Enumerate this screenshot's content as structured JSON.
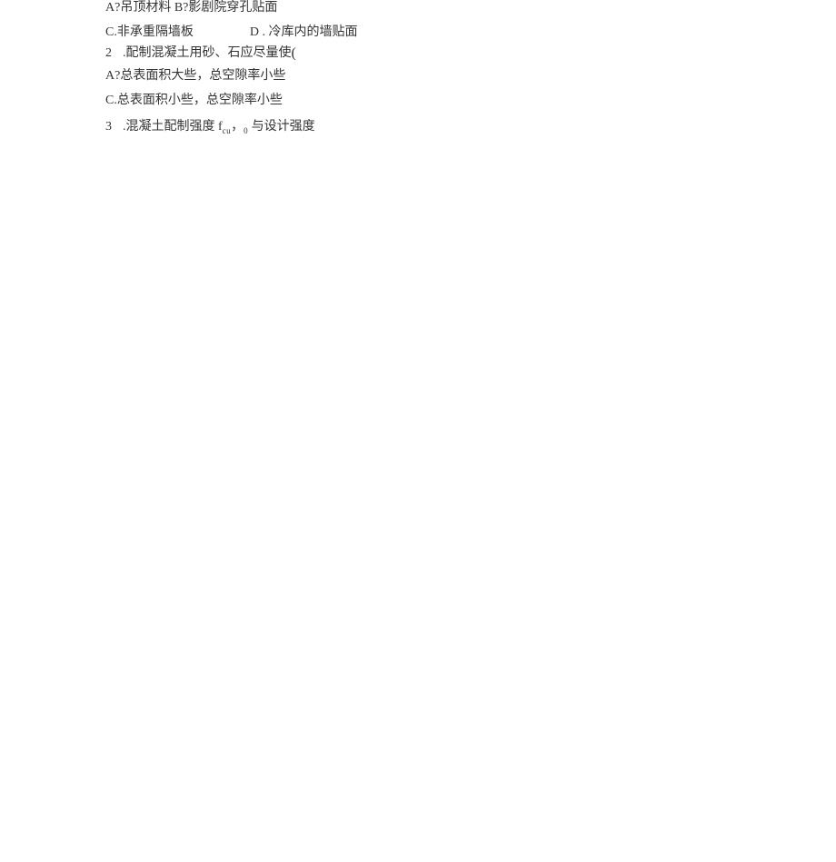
{
  "lines": {
    "l1": "A?吊顶材料 B?影剧院穿孔贴面",
    "l2a": "C.非承重隔墙板",
    "l2b": "D . 冷库内的墙贴面",
    "l3_num": "2",
    "l3_text": ".配制混凝土用砂、石应尽量使",
    "l3_paren": "(",
    "l4": "A?总表面积大些，总空隙率小些",
    "l5": "C.总表面积小些，总空隙率小些",
    "l6_num": "3",
    "l6_a": ".混凝土配制强度 f",
    "l6_sub1": "cu",
    "l6_comma": "，",
    "l6_sub2": "0",
    "l6_b": " 与设计强度"
  }
}
